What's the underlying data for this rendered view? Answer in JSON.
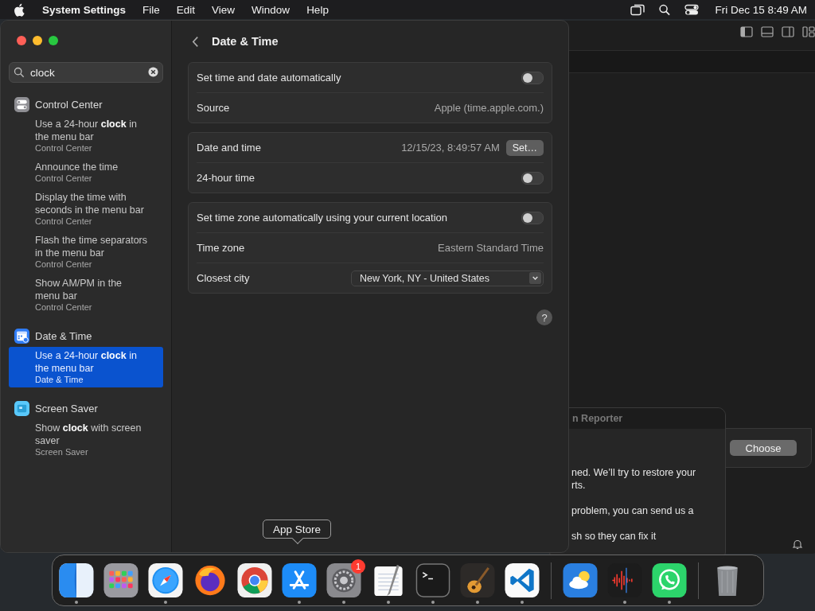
{
  "menu_bar": {
    "app_name": "System Settings",
    "menus": [
      "File",
      "Edit",
      "View",
      "Window",
      "Help"
    ],
    "clock": "Fri Dec 15  8:49 AM"
  },
  "settings": {
    "search": {
      "value": "clock"
    },
    "groups": [
      {
        "title": "Control Center",
        "kind": "control",
        "results": [
          {
            "title": "Use a 24-hour **clock** in the menu bar",
            "subtitle": "Control Center",
            "selected": false
          },
          {
            "title": "Announce the time",
            "subtitle": "Control Center",
            "selected": false
          },
          {
            "title": "Display the time with seconds in the menu bar",
            "subtitle": "Control Center",
            "selected": false
          },
          {
            "title": "Flash the time separators in the menu bar",
            "subtitle": "Control Center",
            "selected": false
          },
          {
            "title": "Show AM/PM in the menu bar",
            "subtitle": "Control Center",
            "selected": false
          }
        ]
      },
      {
        "title": "Date & Time",
        "kind": "calendar",
        "results": [
          {
            "title": "Use a 24-hour **clock** in the menu bar",
            "subtitle": "Date & Time",
            "selected": true
          }
        ]
      },
      {
        "title": "Screen Saver",
        "kind": "screen",
        "results": [
          {
            "title": "Show **clock** with screen saver",
            "subtitle": "Screen Saver",
            "selected": false
          }
        ]
      }
    ],
    "page_title": "Date & Time",
    "sections": [
      {
        "rows": [
          {
            "kind": "toggle",
            "label": "Set time and date automatically",
            "on": false
          },
          {
            "kind": "value",
            "label": "Source",
            "value": "Apple (time.apple.com.)"
          }
        ]
      },
      {
        "rows": [
          {
            "kind": "datetime",
            "label": "Date and time",
            "value": "12/15/23, 8:49:57 AM",
            "button": "Set…"
          },
          {
            "kind": "toggle",
            "label": "24-hour time",
            "on": false
          }
        ]
      },
      {
        "rows": [
          {
            "kind": "toggle",
            "label": "Set time zone automatically using your current location",
            "on": false
          },
          {
            "kind": "value",
            "label": "Time zone",
            "value": "Eastern Standard Time"
          },
          {
            "kind": "popup",
            "label": "Closest city",
            "value": "New York, NY - United States"
          }
        ]
      }
    ],
    "help": "?"
  },
  "background": {
    "reporter_title": "n Reporter",
    "lines": [
      "ned. We’ll try to restore your",
      "rts.",
      "problem, you can send us a",
      "sh so they can fix it"
    ],
    "choose_button": "Choose"
  },
  "dock": {
    "tooltip": "App Store",
    "apps": [
      {
        "kind": "finder",
        "running": true
      },
      {
        "kind": "launchpad",
        "running": false
      },
      {
        "kind": "safari",
        "running": true
      },
      {
        "kind": "firefox",
        "running": false
      },
      {
        "kind": "chrome",
        "running": false
      },
      {
        "kind": "appstore",
        "running": true
      },
      {
        "kind": "settings",
        "running": true,
        "badge": "1"
      },
      {
        "kind": "textedit",
        "running": true
      },
      {
        "kind": "terminal",
        "running": true
      },
      {
        "kind": "garageband",
        "running": true
      },
      {
        "kind": "vscode",
        "running": true
      },
      {
        "kind": "separator"
      },
      {
        "kind": "weather",
        "running": false
      },
      {
        "kind": "voicememo",
        "running": true
      },
      {
        "kind": "whatsapp",
        "running": true
      },
      {
        "kind": "separator"
      },
      {
        "kind": "trash",
        "running": false
      }
    ]
  }
}
